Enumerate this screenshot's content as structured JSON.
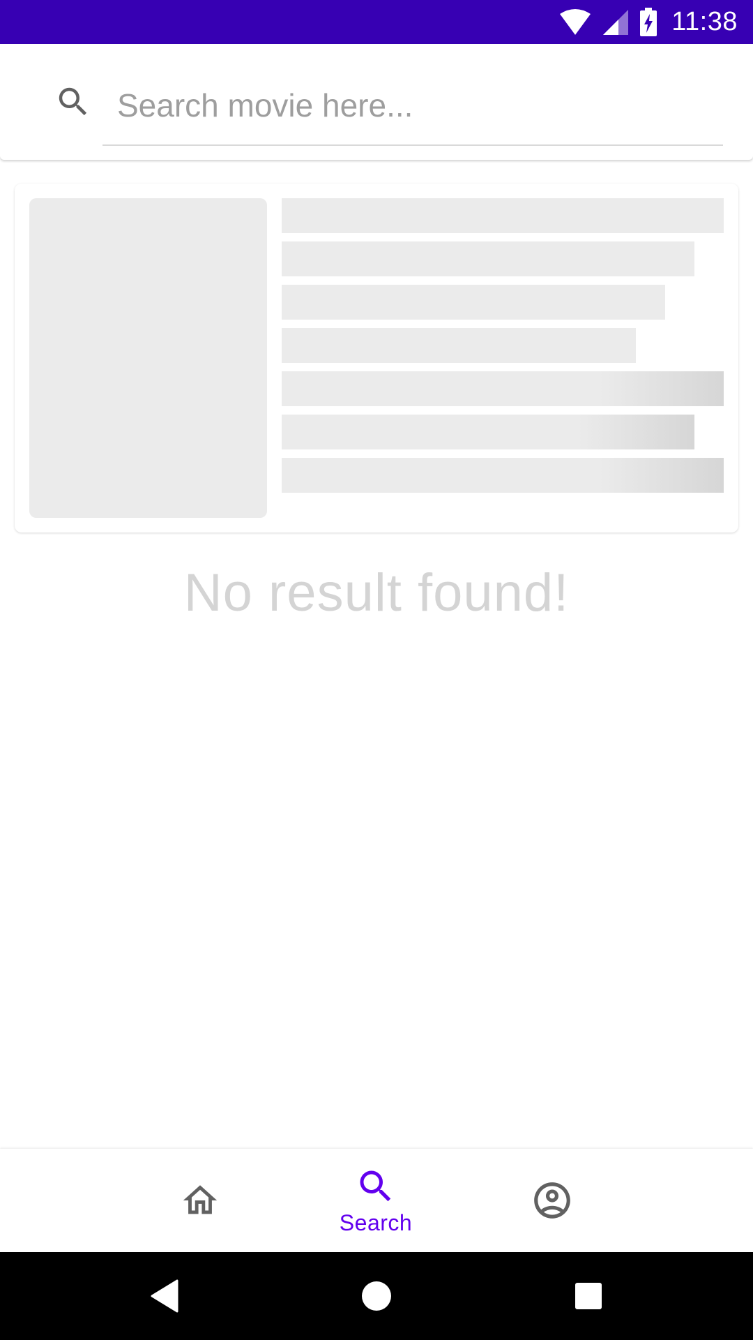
{
  "status_bar": {
    "time": "11:38",
    "background_color": "#3700b3",
    "icons": [
      "wifi-icon",
      "cell-signal-icon",
      "battery-charging-icon"
    ]
  },
  "search": {
    "placeholder": "Search movie here...",
    "value": "",
    "icon": "search-icon"
  },
  "results": {
    "state": "loading-skeleton",
    "empty_message": "No result found!"
  },
  "bottom_nav": {
    "accent_color": "#6200ee",
    "inactive_color": "#616161",
    "items": [
      {
        "icon": "home-icon",
        "label": "",
        "selected": false
      },
      {
        "icon": "search-icon",
        "label": "Search",
        "selected": true
      },
      {
        "icon": "account-circle-icon",
        "label": "",
        "selected": false
      }
    ]
  },
  "system_nav": {
    "buttons": [
      "back-icon",
      "home-circle-icon",
      "recents-icon"
    ]
  }
}
